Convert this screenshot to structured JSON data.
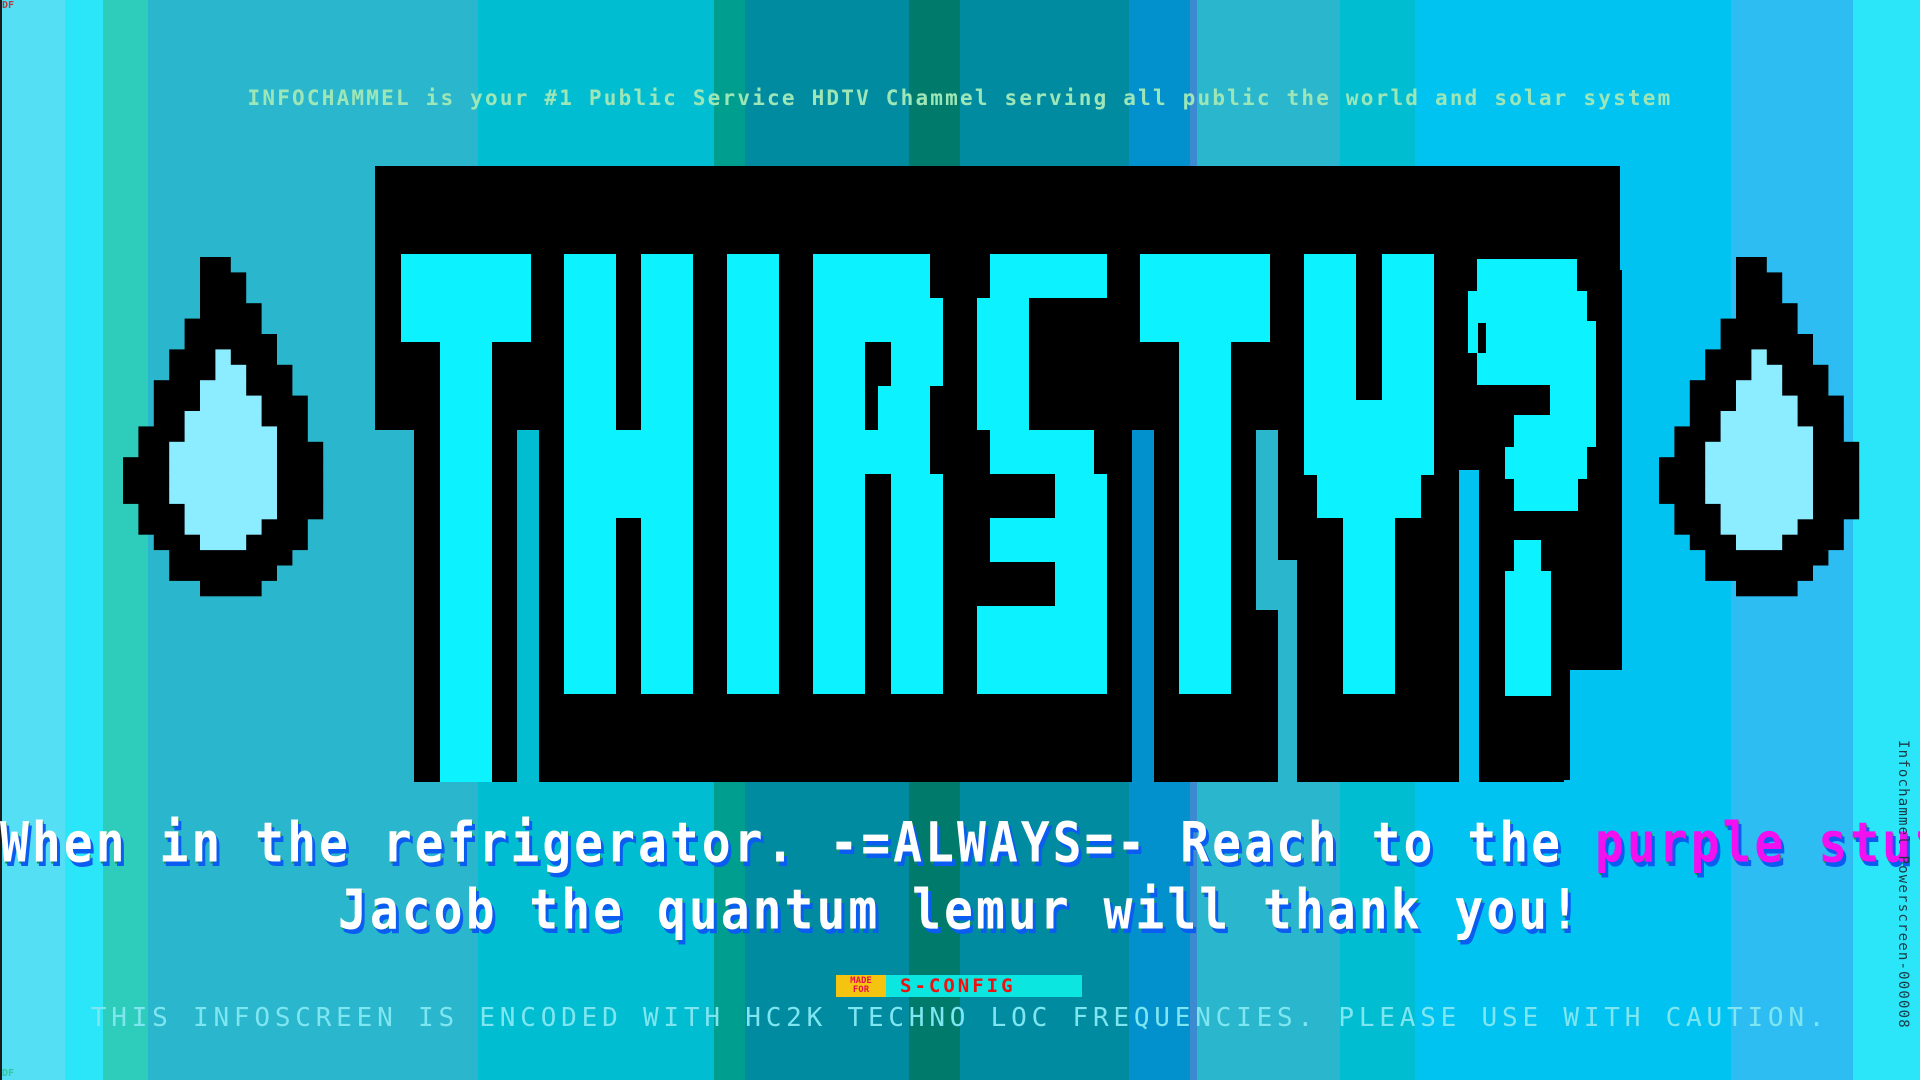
{
  "screen": {
    "corner_tag": "DF",
    "header": "INFOCHAMMEL is your #1 Public Service HDTV Chammel serving all public the world and solar system",
    "title": "THIRSTY?",
    "message": {
      "line1_prefix": "When in the refrigerator. -=ALWAYS=- Reach to the ",
      "line1_highlight": "purple stuff!!",
      "line2": "Jacob the quantum lemur will thank you!"
    },
    "badge": {
      "made_line1": "MADE",
      "made_line2": "FOR",
      "name": "S-CONFIG"
    },
    "caution": "THIS INFOSCREEN IS ENCODED WITH HC2K TECHNO LOC FREQUENCIES.  PLEASE USE WITH CAUTION.",
    "side_label": "Infochammel Powerscreen-000008"
  },
  "colors": {
    "title_fill": "#0CF2FF",
    "title_outline": "#000000",
    "droplet_fill": "#8BEDFF",
    "message_highlight": "#F010F0",
    "header_text": "#9DE6B8",
    "caution_text": "#7EE6F0",
    "stripes": [
      "#55DFF5",
      "#2BE5F8",
      "#2ECDBB",
      "#2AB6CC",
      "#00BDD1",
      "#009E8F",
      "#008BA0",
      "#007A6B",
      "#008BA0",
      "#0291CC",
      "#3C8BD0",
      "#2AB6CC",
      "#00BDD1",
      "#00C3F2",
      "#2DBDF3",
      "#2BE5F8"
    ]
  },
  "icons": {
    "left": "water-droplet",
    "right": "water-droplet"
  }
}
